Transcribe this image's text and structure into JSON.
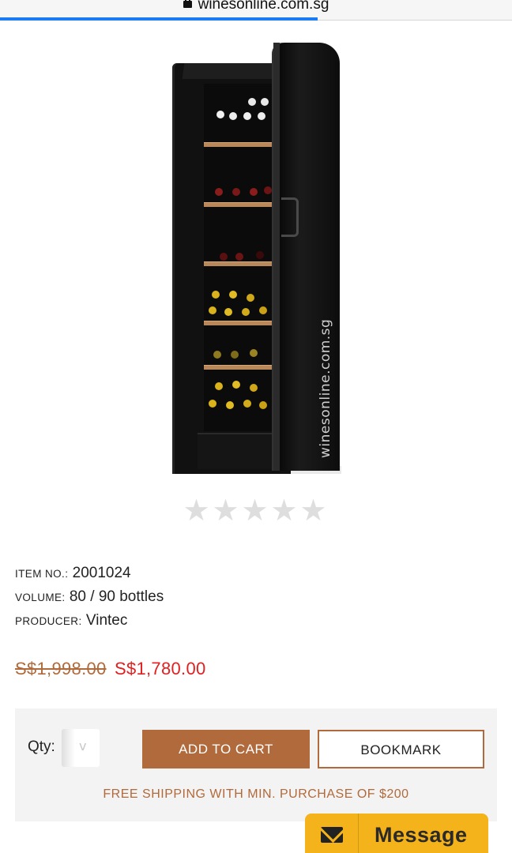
{
  "browser": {
    "url": "winesonline.com.sg",
    "load_progress_percent": 62
  },
  "product": {
    "image_watermark": "winesonline.com.sg",
    "rating": {
      "stars_filled": 0,
      "stars_total": 5
    },
    "details": [
      {
        "label": "ITEM NO.:",
        "value": "2001024"
      },
      {
        "label": "VOLUME:",
        "value": "80 / 90 bottles"
      },
      {
        "label": "PRODUCER:",
        "value": "Vintec"
      }
    ],
    "old_price": "S$1,998.00",
    "new_price": "S$1,780.00"
  },
  "cart": {
    "qty_label": "Qty:",
    "qty_value": "",
    "add_to_cart_label": "ADD TO CART",
    "bookmark_label": "BOOKMARK",
    "free_shipping_text": "FREE SHIPPING WITH MIN. PURCHASE OF $200"
  },
  "message_widget": {
    "label": "Message",
    "icon": "envelope-icon"
  },
  "colors": {
    "accent": "#b06a3b",
    "sale_price": "#e02020",
    "message_widget": "#f4b21b",
    "progress": "#1a7ef2"
  }
}
